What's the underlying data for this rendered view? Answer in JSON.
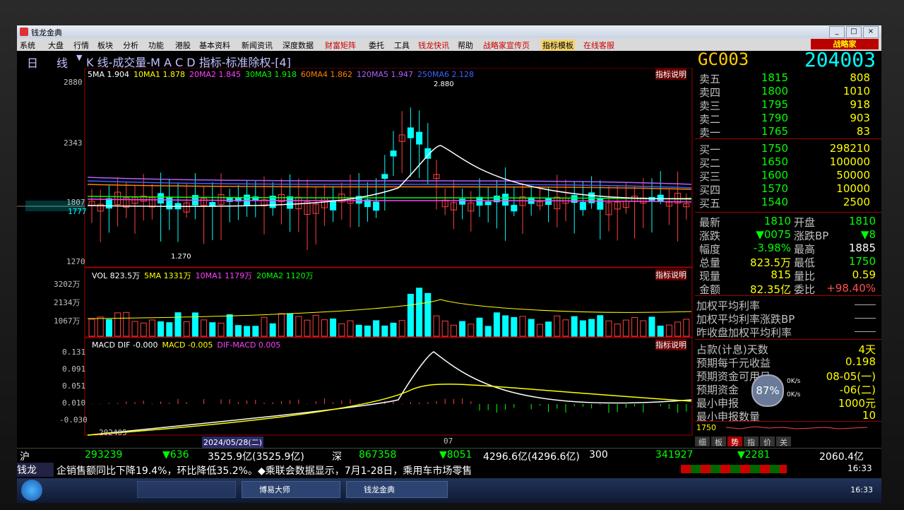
{
  "window": {
    "title": "钱龙金典",
    "controls": [
      "_",
      "□",
      "×"
    ]
  },
  "menu": [
    {
      "label": "系统"
    },
    {
      "label": "大盘"
    },
    {
      "label": "行情"
    },
    {
      "label": "板块"
    },
    {
      "label": "分析"
    },
    {
      "label": "功能"
    },
    {
      "label": "港股"
    },
    {
      "label": "基本资料"
    },
    {
      "label": "新闻资讯"
    },
    {
      "label": "深度数据"
    },
    {
      "label": "财富矩阵",
      "red": true
    },
    {
      "label": "委托"
    },
    {
      "label": "工具"
    },
    {
      "label": "钱龙快讯",
      "red": true
    },
    {
      "label": "帮助"
    },
    {
      "label": "战略家宣传页",
      "red": true
    },
    {
      "label": "指标模板",
      "hl": true
    },
    {
      "label": "在线客服",
      "red": true
    }
  ],
  "brand_button": "战略家",
  "chart_header": {
    "period_a": "日",
    "period_b": "线",
    "title": "K 线-成交量-M A C D 指标-标准除权-[4]"
  },
  "symbol": {
    "code": "GC003",
    "number": "204003"
  },
  "kline": {
    "ma_legend": [
      {
        "text": "5MA 1.904",
        "color": "#ffffff"
      },
      {
        "text": "10MA1 1.878",
        "color": "#ffff00"
      },
      {
        "text": "20MA2 1.845",
        "color": "#ff40ff"
      },
      {
        "text": "30MA3 1.918",
        "color": "#00ff00"
      },
      {
        "text": "60MA4 1.862",
        "color": "#ff8000"
      },
      {
        "text": "120MA5 1.947",
        "color": "#b060ff"
      },
      {
        "text": "250MA6 2.128",
        "color": "#4060ff"
      }
    ],
    "help": "指标说明",
    "y_ticks": [
      "2880",
      "2343",
      "1807",
      "1270"
    ],
    "cursor_value": "1777",
    "high_label": "2.880",
    "low_label": "1.270"
  },
  "volume": {
    "legend": [
      {
        "text": "VOL 823.5万",
        "color": "#ffffff"
      },
      {
        "text": "5MA 1331万",
        "color": "#ffff00"
      },
      {
        "text": "10MA1 1179万",
        "color": "#ff40ff"
      },
      {
        "text": "20MA2 1120万",
        "color": "#00ff00"
      }
    ],
    "help": "指标说明",
    "y_ticks": [
      "3202万",
      "2134万",
      "1067万"
    ]
  },
  "macd": {
    "legend": [
      {
        "text": "MACD DIF -0.000",
        "color": "#ffffff"
      },
      {
        "text": "MACD -0.005",
        "color": "#ffff00"
      },
      {
        "text": "DIF-MACD 0.005",
        "color": "#ff40ff"
      }
    ],
    "help": "指标说明",
    "y_ticks": [
      "0.131",
      "0.091",
      "0.051",
      "0.010",
      "-0.030"
    ],
    "x_labels": [
      "202405",
      "07"
    ],
    "cursor_date": "2024/05/28(二)"
  },
  "orderbook": {
    "asks": [
      {
        "label": "卖五",
        "price": "1815",
        "vol": "808"
      },
      {
        "label": "卖四",
        "price": "1800",
        "vol": "1010"
      },
      {
        "label": "卖三",
        "price": "1795",
        "vol": "918"
      },
      {
        "label": "卖二",
        "price": "1790",
        "vol": "903"
      },
      {
        "label": "卖一",
        "price": "1765",
        "vol": "83"
      }
    ],
    "bids": [
      {
        "label": "买一",
        "price": "1750",
        "vol": "298210"
      },
      {
        "label": "买二",
        "price": "1650",
        "vol": "100000"
      },
      {
        "label": "买三",
        "price": "1600",
        "vol": "50000"
      },
      {
        "label": "买四",
        "price": "1570",
        "vol": "10000"
      },
      {
        "label": "买五",
        "price": "1540",
        "vol": "2500"
      }
    ]
  },
  "quote": [
    {
      "l1": "最新",
      "v1": "1810",
      "c1": "g",
      "l2": "开盘",
      "v2": "1810",
      "c2": "g"
    },
    {
      "l1": "涨跌",
      "v1": "▼0075",
      "c1": "g",
      "l2": "涨跌BP",
      "v2": "▼8",
      "c2": "g"
    },
    {
      "l1": "幅度",
      "v1": "-3.98%",
      "c1": "g",
      "l2": "最高",
      "v2": "1885",
      "c2": "w"
    },
    {
      "l1": "总量",
      "v1": "823.5万",
      "c1": "y",
      "l2": "最低",
      "v2": "1750",
      "c2": "g"
    },
    {
      "l1": "现量",
      "v1": "815",
      "c1": "y",
      "l2": "量比",
      "v2": "0.59",
      "c2": "y"
    },
    {
      "l1": "金额",
      "v1": "82.35亿",
      "c1": "y",
      "l2": "委比",
      "v2": "+98.40%",
      "c2": "r"
    }
  ],
  "rates": [
    "加权平均利率",
    "加权平均利率涨跌BP",
    "昨收盘加权平均利率"
  ],
  "info": [
    {
      "label": "占款(计息)天数",
      "value": "4天"
    },
    {
      "label": "预期每千元收益",
      "value": "0.198"
    },
    {
      "label": "预期资金可用日",
      "value": "08-05(一)"
    },
    {
      "label": "预期资金",
      "value": "-06(二)"
    },
    {
      "label": "最小申报",
      "value": "1000元"
    },
    {
      "label": "最小申报数量",
      "value": "10"
    }
  ],
  "overlay": {
    "percent": "87%",
    "k1": "0K/s",
    "k2": "0K/s"
  },
  "mini_price": "1750",
  "mini_tabs": [
    "细",
    "板",
    "势",
    "指",
    "价",
    "关"
  ],
  "ticker_row": {
    "sh_label": "沪",
    "sh_idx": "293239",
    "sh_chg": "▼636",
    "sh_amt": "3525.9亿(3525.9亿)",
    "sz_label": "深",
    "sz_idx": "867358",
    "sz_chg": "▼8051",
    "sz_amt": "4296.6亿(4296.6亿)",
    "c_label": "300",
    "c_idx": "341927",
    "c_chg": "▼2281",
    "c_amt": "2060.4亿"
  },
  "news": {
    "brand": "钱龙",
    "text": "企销售额同比下降19.4%，环比降低35.2%。◆乘联会数据显示，7月1-28日，乘用车市场零售",
    "time": "16:33"
  },
  "taskbar": {
    "items": [
      "",
      "博易大师",
      "钱龙金典"
    ],
    "time": "16:33"
  }
}
